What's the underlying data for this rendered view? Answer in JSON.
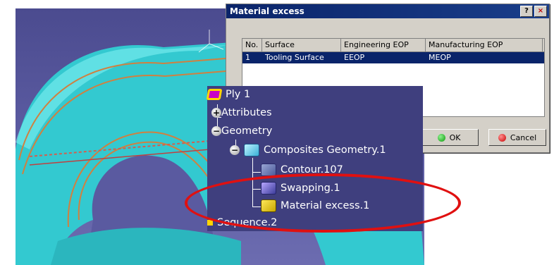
{
  "dialog": {
    "title": "Material excess",
    "help_label": "?",
    "close_label": "×",
    "columns": [
      "No.",
      "Surface",
      "Engineering EOP",
      "Manufacturing EOP"
    ],
    "rows": [
      {
        "no": "1",
        "surface": "Tooling Surface",
        "engineering_eop": "EEOP",
        "manufacturing_eop": "MEOP"
      }
    ],
    "ok_label": "OK",
    "cancel_label": "Cancel"
  },
  "tree": {
    "root": "Ply 1",
    "attributes": "Attributes",
    "geometry": "Geometry",
    "composites_geometry": "Composites Geometry.1",
    "contour": "Contour.107",
    "swapping": "Swapping.1",
    "material_excess": "Material excess.1",
    "sequence": "Sequence.2"
  },
  "colors": {
    "viewport_bg": "#4b4b8f",
    "part_surface": "#38d6dc",
    "highlight_ellipse": "#e01010",
    "selection": "#0a246a"
  }
}
